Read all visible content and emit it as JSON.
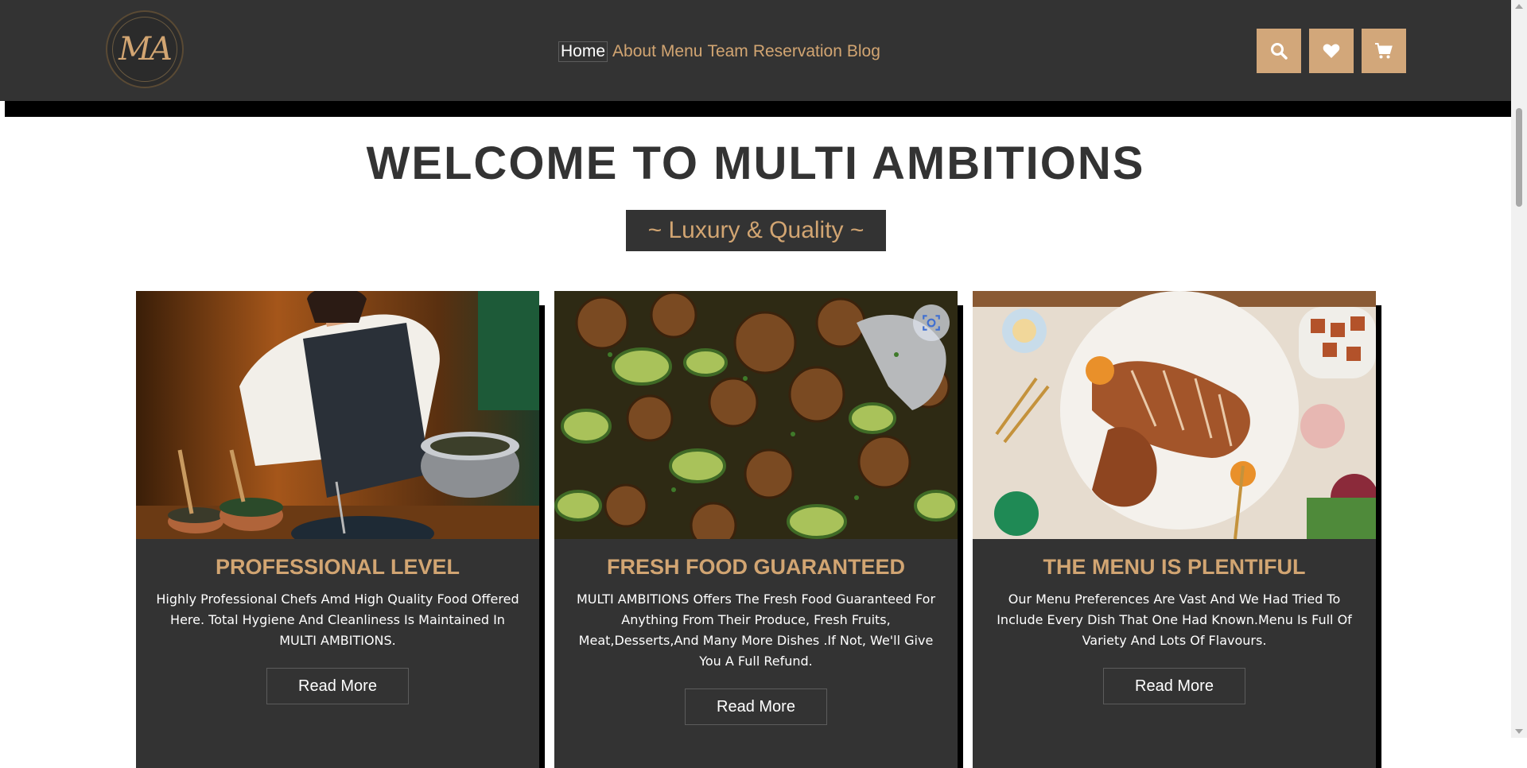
{
  "brand": {
    "logo_text": "MA",
    "accent_color": "#d2a572",
    "dark_color": "#333333"
  },
  "nav": {
    "items": [
      {
        "label": "Home",
        "active": true
      },
      {
        "label": "About",
        "active": false
      },
      {
        "label": "Menu",
        "active": false
      },
      {
        "label": "Team",
        "active": false
      },
      {
        "label": "Reservation",
        "active": false
      },
      {
        "label": "Blog",
        "active": false
      }
    ]
  },
  "header_icons": [
    "search-icon",
    "heart-icon",
    "cart-icon"
  ],
  "hero": {
    "title": "WELCOME TO MULTI AMBITIONS",
    "tagline": "~ Luxury & Quality ~"
  },
  "cards": [
    {
      "image": "chef-cooking-photo",
      "title": "PROFESSIONAL LEVEL",
      "text": "Highly Professional Chefs Amd High Quality Food Offered Here. Total Hygiene And Cleanliness Is Maintained In MULTI AMBITIONS.",
      "button": "Read More"
    },
    {
      "image": "mushroom-zucchini-photo",
      "title": "FRESH FOOD GUARANTEED",
      "text": "MULTI AMBITIONS Offers The Fresh Food Guaranteed For Anything From Their Produce, Fresh Fruits, Meat,Desserts,And Many More Dishes .If Not, We'll Give You A Full Refund.",
      "button": "Read More"
    },
    {
      "image": "roast-dinner-table-photo",
      "title": "THE MENU IS PLENTIFUL",
      "text": "Our Menu Preferences Are Vast And We Had Tried To Include Every Dish That One Had Known.Menu Is Full Of Variety And Lots Of Flavours.",
      "button": "Read More"
    }
  ]
}
